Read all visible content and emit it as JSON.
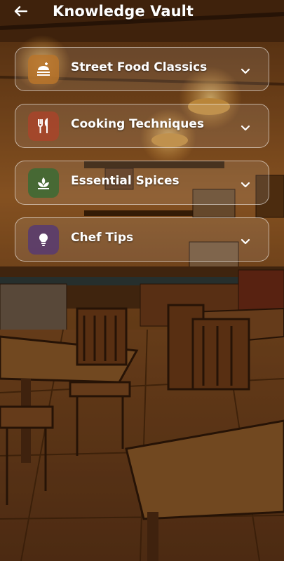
{
  "header": {
    "title": "Knowledge Vault",
    "back_icon": "arrow-left-icon"
  },
  "sections": [
    {
      "label": "Street Food Classics",
      "icon": "food-plate-icon",
      "icon_color": "#b8742a"
    },
    {
      "label": "Cooking Techniques",
      "icon": "utensils-icon",
      "icon_color": "#a9442a"
    },
    {
      "label": "Essential Spices",
      "icon": "herb-leaf-icon",
      "icon_color": "#3f6a34"
    },
    {
      "label": "Chef Tips",
      "icon": "lightbulb-icon",
      "icon_color": "#5a3c6e"
    }
  ],
  "colors": {
    "text": "#ffffff",
    "card_border": "#ffffff"
  }
}
